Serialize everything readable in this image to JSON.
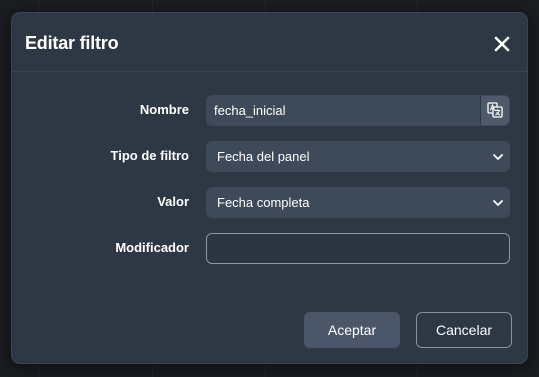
{
  "dialog": {
    "title": "Editar filtro",
    "close_icon": "close-icon"
  },
  "form": {
    "name_label": "Nombre",
    "name_value": "fecha_inicial",
    "translate_icon": "translate-icon",
    "filter_type_label": "Tipo de filtro",
    "filter_type_value": "Fecha del panel",
    "value_label": "Valor",
    "value_value": "Fecha completa",
    "modifier_label": "Modificador",
    "modifier_value": ""
  },
  "buttons": {
    "accept_label": "Aceptar",
    "cancel_label": "Cancelar"
  },
  "colors": {
    "dialog_bg": "#2e3744",
    "field_bg": "#3e4959",
    "accent_button": "#4b5768"
  }
}
